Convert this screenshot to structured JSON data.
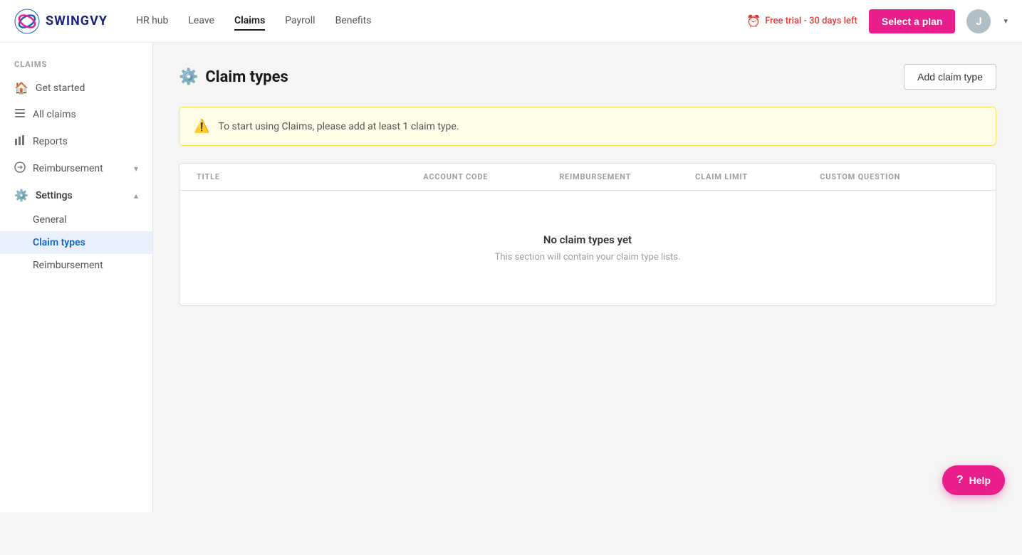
{
  "brand": {
    "name": "SWINGVY"
  },
  "topnav": {
    "links": [
      {
        "id": "hr-hub",
        "label": "HR hub",
        "active": false
      },
      {
        "id": "leave",
        "label": "Leave",
        "active": false
      },
      {
        "id": "claims",
        "label": "Claims",
        "active": true
      },
      {
        "id": "payroll",
        "label": "Payroll",
        "active": false
      },
      {
        "id": "benefits",
        "label": "Benefits",
        "active": false
      }
    ],
    "trial_text": "Free trial - 30 days left",
    "select_plan_label": "Select a plan",
    "avatar_initial": "J"
  },
  "sidebar": {
    "section_label": "CLAIMS",
    "items": [
      {
        "id": "get-started",
        "label": "Get started",
        "icon": "🏠"
      },
      {
        "id": "all-claims",
        "label": "All claims",
        "icon": "☰"
      },
      {
        "id": "reports",
        "label": "Reports",
        "icon": "📊"
      },
      {
        "id": "reimbursement",
        "label": "Reimbursement",
        "icon": "↩",
        "has_arrow": true
      },
      {
        "id": "settings",
        "label": "Settings",
        "icon": "⚙️",
        "expanded": true
      }
    ],
    "settings_sub_items": [
      {
        "id": "general",
        "label": "General"
      },
      {
        "id": "claim-types",
        "label": "Claim types",
        "active": true
      },
      {
        "id": "reimbursement-sub",
        "label": "Reimbursement"
      }
    ]
  },
  "page": {
    "title": "Claim types",
    "title_icon": "⚙️",
    "add_button_label": "Add claim type"
  },
  "warning": {
    "text": "To start using Claims, please add at least 1 claim type."
  },
  "table": {
    "columns": [
      "TITLE",
      "ACCOUNT CODE",
      "REIMBURSEMENT",
      "CLAIM LIMIT",
      "CUSTOM QUESTION"
    ],
    "empty_title": "No claim types yet",
    "empty_subtitle": "This section will contain your claim type lists."
  },
  "help": {
    "label": "Help"
  }
}
